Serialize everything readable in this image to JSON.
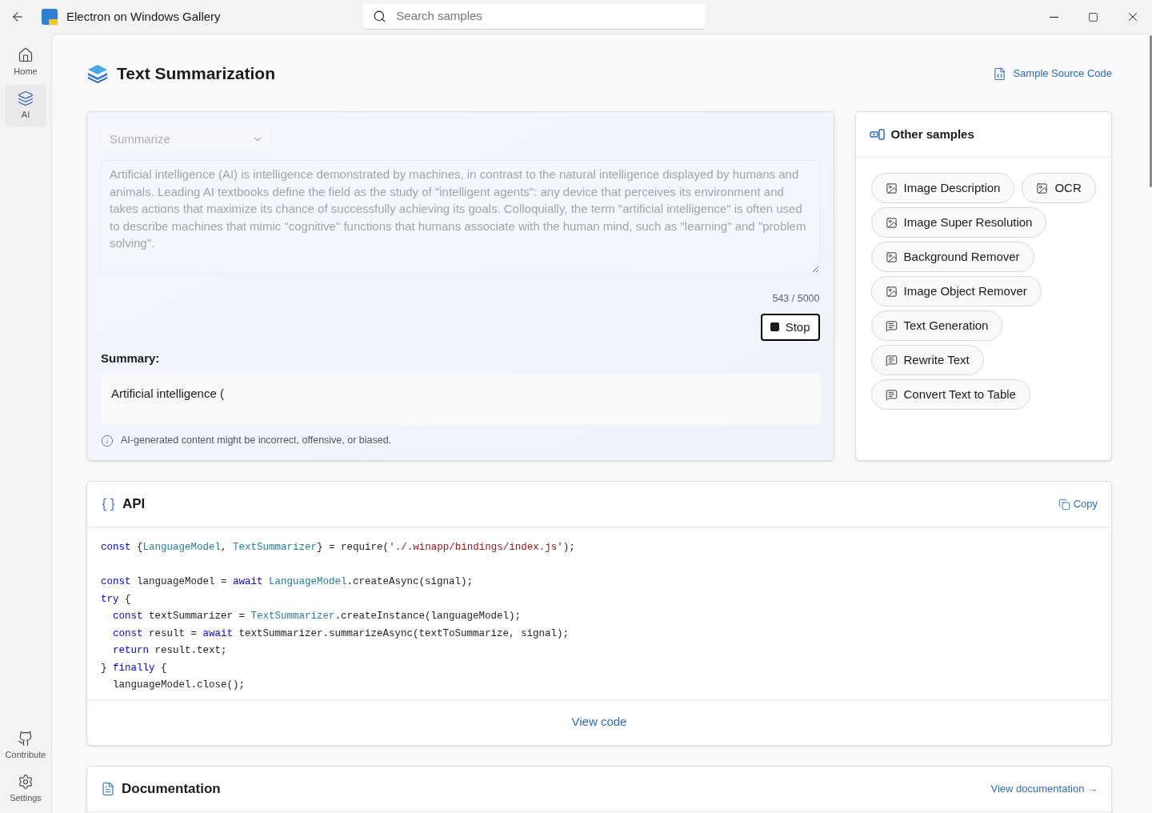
{
  "window": {
    "title": "Electron on Windows Gallery"
  },
  "search": {
    "placeholder": "Search samples"
  },
  "nav": [
    {
      "label": "Home",
      "kind": "home",
      "selected": false
    },
    {
      "label": "AI",
      "kind": "layers",
      "selected": true
    }
  ],
  "nav_bottom": [
    {
      "label": "Contribute",
      "kind": "github"
    },
    {
      "label": "Settings",
      "kind": "gear"
    }
  ],
  "page": {
    "title": "Text Summarization",
    "source_link": "Sample Source Code"
  },
  "demo": {
    "mode": {
      "value": "Summarize",
      "disabled": true
    },
    "input": {
      "value": "Artificial intelligence (AI) is intelligence demonstrated by machines, in contrast to the natural intelligence displayed by humans and animals. Leading AI textbooks define the field as the study of \"intelligent agents\": any device that perceives its environment and takes actions that maximize its chance of successfully achieving its goals. Colloquially, the term \"artificial intelligence\" is often used to describe machines that mimic \"cognitive\" functions that humans associate with the human mind, such as \"learning\" and \"problem solving\".",
      "disabled": true
    },
    "counter": "543 / 5000",
    "button": "Stop",
    "summary_label": "Summary:",
    "summary": "Artificial intelligence (",
    "disclaimer": "AI-generated content might be incorrect, offensive, or biased."
  },
  "other_samples": {
    "title": "Other samples",
    "items": [
      {
        "label": "Image Description",
        "kind": "image"
      },
      {
        "label": "OCR",
        "kind": "image"
      },
      {
        "label": "Image Super Resolution",
        "kind": "image"
      },
      {
        "label": "Background Remover",
        "kind": "image"
      },
      {
        "label": "Image Object Remover",
        "kind": "image"
      },
      {
        "label": "Text Generation",
        "kind": "chat"
      },
      {
        "label": "Rewrite Text",
        "kind": "chat"
      },
      {
        "label": "Convert Text to Table",
        "kind": "chat"
      }
    ]
  },
  "api": {
    "title": "API",
    "copy": "Copy",
    "code_blocks": [
      [
        [
          {
            "kind": "kw",
            "text": "const "
          },
          {
            "kind": "plain",
            "text": "{"
          },
          {
            "kind": "type",
            "text": "LanguageModel"
          },
          {
            "kind": "plain",
            "text": ", "
          },
          {
            "kind": "type",
            "text": "TextSummarizer"
          },
          {
            "kind": "plain",
            "text": "} = require("
          },
          {
            "kind": "str",
            "text": "'./.winapp/bindings/index.js'"
          },
          {
            "kind": "plain",
            "text": ");"
          }
        ]
      ],
      [
        [
          {
            "kind": "kw",
            "text": "const "
          },
          {
            "kind": "plain",
            "text": "languageModel = "
          },
          {
            "kind": "kw",
            "text": "await "
          },
          {
            "kind": "type",
            "text": "LanguageModel"
          },
          {
            "kind": "plain",
            "text": ".createAsync(signal);"
          }
        ],
        [
          {
            "kind": "kw",
            "text": "try "
          },
          {
            "kind": "plain",
            "text": "{"
          }
        ],
        [
          {
            "kind": "kw",
            "text": "  const "
          },
          {
            "kind": "plain",
            "text": "textSummarizer = "
          },
          {
            "kind": "type",
            "text": "TextSummarizer"
          },
          {
            "kind": "plain",
            "text": ".createInstance(languageModel);"
          }
        ],
        [
          {
            "kind": "kw",
            "text": "  const "
          },
          {
            "kind": "plain",
            "text": "result = "
          },
          {
            "kind": "kw",
            "text": "await "
          },
          {
            "kind": "plain",
            "text": "textSummarizer.summarizeAsync(textToSummarize, signal);"
          }
        ],
        [
          {
            "kind": "kw",
            "text": "  return "
          },
          {
            "kind": "plain",
            "text": "result.text;"
          }
        ],
        [
          {
            "kind": "plain",
            "text": "} "
          },
          {
            "kind": "kw",
            "text": "finally "
          },
          {
            "kind": "plain",
            "text": "{"
          }
        ],
        [
          {
            "kind": "plain",
            "text": "  languageModel.close();"
          }
        ]
      ]
    ],
    "view_code": "View code"
  },
  "documentation": {
    "title": "Documentation",
    "link": "View documentation →"
  }
}
